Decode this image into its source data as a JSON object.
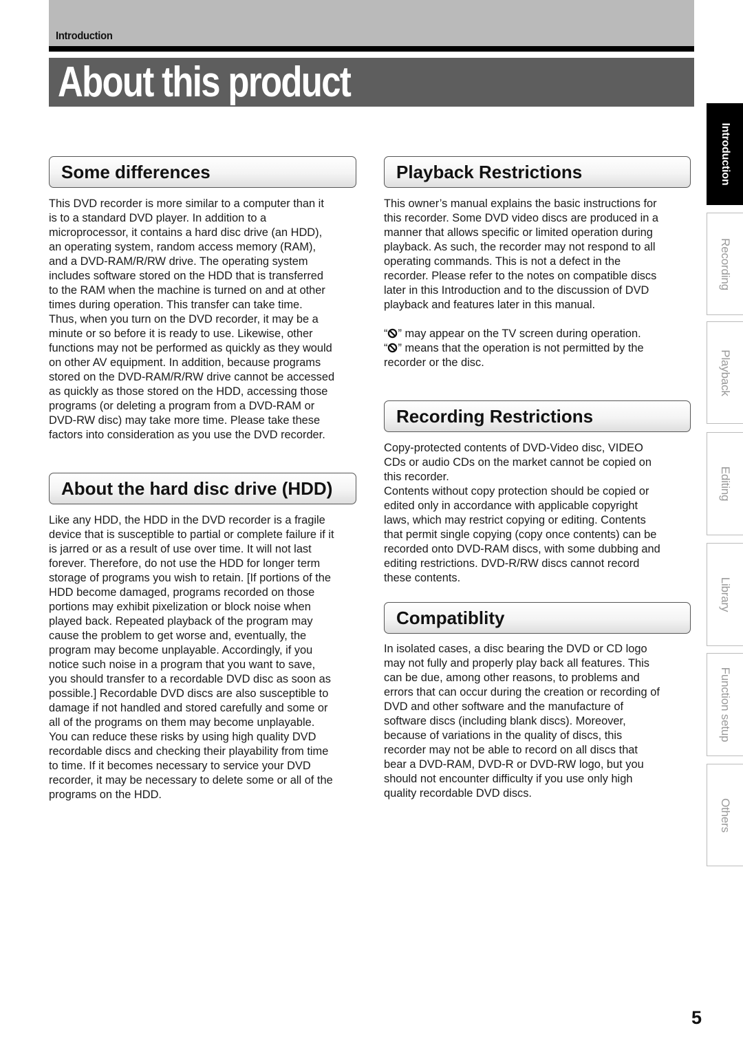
{
  "header": {
    "breadcrumb": "Introduction",
    "title": "About this product"
  },
  "sections": {
    "some_differences": {
      "heading": "Some differences",
      "body": "This DVD recorder is more similar to a computer than it\nis to a standard DVD player.  In addition to a\nmicroprocessor, it contains a hard disc drive (an HDD),\nan operating system,  random access memory (RAM),\nand a DVD-RAM/R/RW drive.  The operating system\nincludes software stored on the HDD that is transferred\nto the RAM when the machine is turned on and at other\ntimes during operation.  This transfer can take time.\nThus, when you turn on the DVD recorder, it may be a\nminute or so before it is ready to use.  Likewise, other\nfunctions may not be performed as quickly as they would\non other AV equipment.  In addition, because programs\nstored on the DVD-RAM/R/RW drive cannot be accessed\nas quickly as those stored on the HDD, accessing those\nprograms (or deleting a program from a DVD-RAM or\nDVD-RW disc) may take more time.  Please take these\nfactors into consideration as you use the DVD recorder."
    },
    "hdd": {
      "heading": "About the hard disc drive (HDD)",
      "body": "Like any HDD, the HDD in the DVD recorder is a fragile\ndevice that is susceptible to partial or complete failure if it\nis jarred or as a result of use over time. It will not last\nforever. Therefore, do not use the HDD for longer term\nstorage of programs you wish to retain.  [If portions of the\nHDD become damaged, programs recorded on those\nportions may exhibit pixelization or block noise when\nplayed back. Repeated playback of the program may\ncause the problem to get worse and, eventually, the\nprogram may become unplayable.  Accordingly, if you\nnotice such noise in a program that you want to save,\nyou should transfer to a recordable DVD disc as soon as\npossible.]  Recordable DVD discs are also susceptible to\ndamage if not handled and stored carefully and some or\nall of the programs on them may become unplayable.\nYou can reduce these risks by using high quality DVD\nrecordable discs and checking their playability from time\nto time.  If it becomes necessary to service your DVD\nrecorder, it may be necessary to delete some or all of the\nprograms on the HDD."
    },
    "playback_restrictions": {
      "heading": "Playback Restrictions",
      "body": "This owner’s manual explains the basic instructions for\nthis recorder. Some DVD video discs are produced in a\nmanner that allows specific or limited operation during\nplayback. As such, the recorder may not respond to all\noperating commands. This is not a defect in the\nrecorder. Please refer to the notes on compatible discs\nlater in this Introduction and to the discussion of DVD\nplayback and features later in this manual.",
      "note_line1_open": "“",
      "note_line1_rest": "” may appear on the TV screen during operation.",
      "note_line2_open": "“",
      "note_line2_rest": "” means that the operation is not permitted by the\nrecorder or the disc.",
      "note_icon": "prohibited-icon"
    },
    "recording_restrictions": {
      "heading": "Recording Restrictions",
      "body": "Copy-protected contents of DVD-Video disc, VIDEO\nCDs or audio CDs on the market cannot be copied on\nthis recorder.\nContents without copy protection should be copied or\nedited only in accordance with applicable copyright\nlaws, which may restrict copying or editing. Contents\nthat permit single copying (copy once contents) can be\nrecorded onto DVD-RAM discs, with some dubbing and\nediting restrictions. DVD-R/RW discs cannot record\nthese contents."
    },
    "compatibility": {
      "heading": "Compatiblity",
      "body": "In isolated cases, a disc bearing the DVD or CD logo\nmay not fully and properly play back all features.  This\ncan be due, among other reasons, to problems and\nerrors that can occur during the creation or recording of\nDVD and other software and the manufacture of\nsoftware discs (including blank discs).  Moreover,\nbecause of variations in the quality of discs, this\nrecorder may not be able to record on all discs that\nbear a DVD-RAM, DVD-R or DVD-RW logo, but you\nshould not encounter difficulty if you use only high\nquality recordable DVD discs."
    }
  },
  "side_tabs": [
    {
      "label": "Introduction",
      "active": true
    },
    {
      "label": "Recording",
      "active": false
    },
    {
      "label": "Playback",
      "active": false
    },
    {
      "label": "Editing",
      "active": false
    },
    {
      "label": "Library",
      "active": false
    },
    {
      "label": "Function setup",
      "active": false
    },
    {
      "label": "Others",
      "active": false
    }
  ],
  "footer": {
    "page_number": "5"
  }
}
